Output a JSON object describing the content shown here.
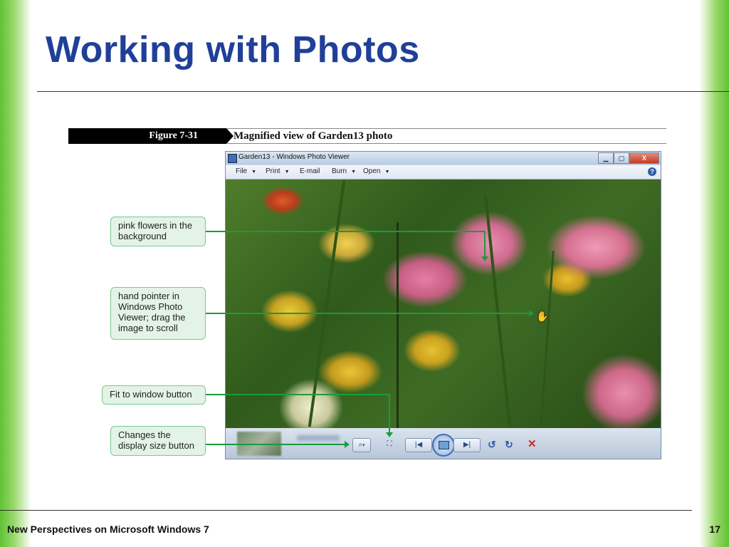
{
  "slide": {
    "title": "Working with Photos",
    "footer": "New Perspectives on Microsoft Windows 7",
    "page_number": "17"
  },
  "figure": {
    "label": "Figure 7-31",
    "caption": "Magnified view of Garden13 photo"
  },
  "window": {
    "title": "Garden13 - Windows Photo Viewer",
    "buttons": {
      "minimize": "▁",
      "maximize": "▢",
      "close": "X"
    },
    "menu": [
      {
        "label": "File",
        "has_dropdown": true
      },
      {
        "label": "Print",
        "has_dropdown": true
      },
      {
        "label": "E-mail",
        "has_dropdown": false
      },
      {
        "label": "Burn",
        "has_dropdown": true
      },
      {
        "label": "Open",
        "has_dropdown": true
      }
    ],
    "help_icon": "?",
    "controls": {
      "zoom": "⌕",
      "fit_to_window": "⛶",
      "previous": "|◀",
      "next": "▶|",
      "rotate_ccw": "↺",
      "rotate_cw": "↻",
      "delete": "✕"
    }
  },
  "callouts": [
    {
      "id": "pink-flowers",
      "text": "pink flowers in the background"
    },
    {
      "id": "hand-pointer",
      "text": "hand pointer in Windows Photo Viewer; drag the image to scroll"
    },
    {
      "id": "fit-to-window",
      "text": "Fit to window button"
    },
    {
      "id": "changes-display-size",
      "text": "Changes the display size button"
    }
  ],
  "colors": {
    "title": "#1f3f99",
    "accent_green": "#5fc233",
    "callout_fill": "#e3f3e6",
    "callout_line": "#1a9c3c"
  }
}
